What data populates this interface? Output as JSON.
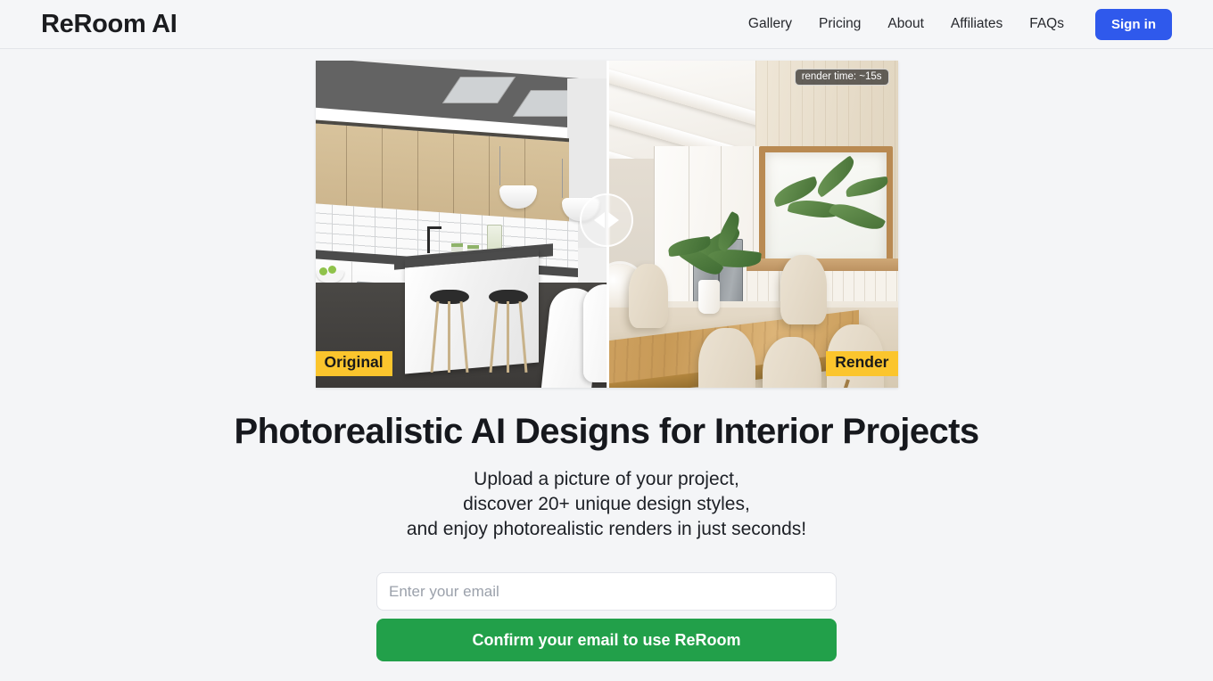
{
  "header": {
    "brand": "ReRoom AI",
    "nav": [
      {
        "label": "Gallery"
      },
      {
        "label": "Pricing"
      },
      {
        "label": "About"
      },
      {
        "label": "Affiliates"
      },
      {
        "label": "FAQs"
      }
    ],
    "signin_label": "Sign in"
  },
  "compare": {
    "badge_left": "Original",
    "badge_right": "Render",
    "render_time": "render time: ~15s",
    "left_alt": "grayscale 3D model kitchen with wood upper cabinets, white subway tile, island and bar stools",
    "right_alt": "photorealistic bright dining room with wood table, beige chairs, plant and white beams"
  },
  "hero": {
    "headline": "Photorealistic AI Designs for Interior Projects",
    "sub_line1": "Upload a picture of your project,",
    "sub_line2": "discover 20+ unique design styles,",
    "sub_line3": "and enjoy photorealistic renders in just seconds!"
  },
  "form": {
    "email_value": "",
    "email_placeholder": "Enter your email",
    "cta_label": "Confirm your email to use ReRoom"
  },
  "colors": {
    "page_bg": "#f4f5f7",
    "accent_blue": "#2f59ec",
    "accent_green": "#22a04a",
    "badge_yellow": "#fbc52d",
    "text_dark": "#16181d"
  }
}
